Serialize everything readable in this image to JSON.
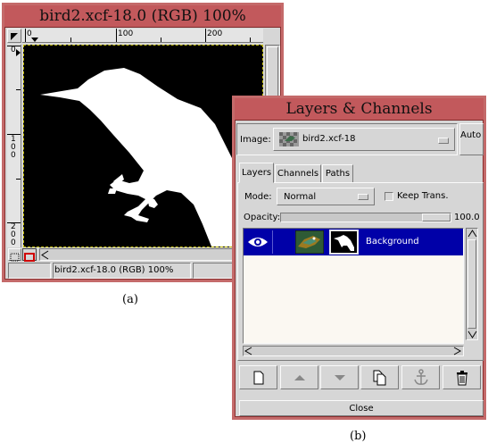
{
  "image_window": {
    "title": "bird2.xcf-18.0 (RGB) 100%",
    "ruler_top_labels": [
      "0",
      "100",
      "200"
    ],
    "ruler_left_labels": [
      "0",
      "1\n0\n0",
      "2\n0\n0"
    ],
    "status_text": "bird2.xcf-18.0 (RGB) 100%",
    "caption": "(a)"
  },
  "layers_window": {
    "title": "Layers & Channels",
    "image_label": "Image:",
    "image_selected": "bird2.xcf-18",
    "auto_label": "Auto",
    "tabs": [
      {
        "label": "Layers"
      },
      {
        "label": "Channels"
      },
      {
        "label": "Paths"
      }
    ],
    "mode_label": "Mode:",
    "mode_value": "Normal",
    "keep_trans_label": "Keep Trans.",
    "opacity_label": "Opacity:",
    "opacity_value": "100.0",
    "opacity_fraction": 1.0,
    "layers": [
      {
        "name": "Background",
        "visible": true,
        "selected": true
      }
    ],
    "toolbar_icons": [
      "new-layer-icon",
      "raise-layer-icon",
      "lower-layer-icon",
      "duplicate-layer-icon",
      "anchor-layer-icon",
      "delete-layer-icon"
    ],
    "close_label": "Close",
    "caption": "(b)"
  },
  "colors": {
    "titlebar": "#c2595c",
    "window_border": "#c46a6a",
    "selection": "#0000a8",
    "panel": "#d6d6d6"
  }
}
